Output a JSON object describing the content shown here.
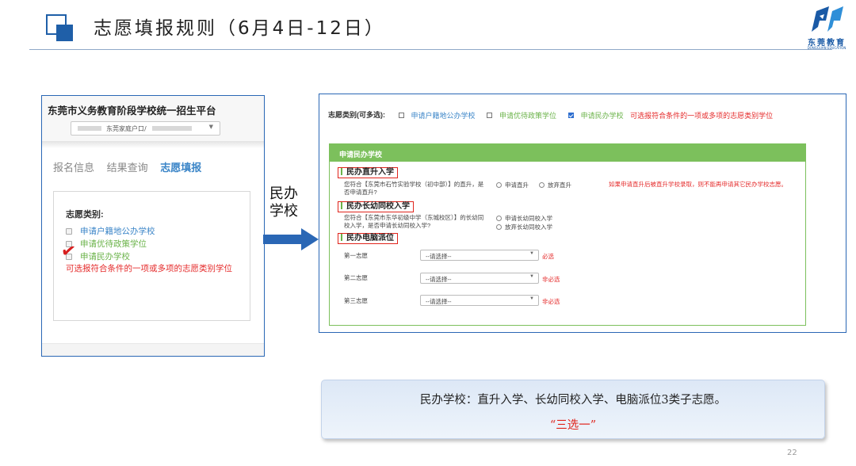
{
  "slide": {
    "title": "志愿填报规则（6月4日-12日）",
    "page_number": "22",
    "logo": {
      "name": "东莞教育",
      "sub": "DONGGUAN EDUCATION"
    }
  },
  "left_screen": {
    "platform_title": "东莞市义务教育阶段学校统一招生平台",
    "account_select": "东莞家庭户口/",
    "tabs": [
      {
        "label": "报名信息",
        "active": false
      },
      {
        "label": "结果查询",
        "active": false
      },
      {
        "label": "志愿填报",
        "active": true
      }
    ],
    "category_label": "志愿类别:",
    "options": [
      {
        "label": "申请户籍地公办学校",
        "color": "#3c86c8"
      },
      {
        "label": "申请优待政策学位",
        "color": "#6bb34a"
      },
      {
        "label": "申请民办学校",
        "color": "#6bb34a"
      }
    ],
    "note": "可选报符合条件的一项或多项的志愿类别学位"
  },
  "middle": {
    "label": "民办学校"
  },
  "right_screen": {
    "category_label": "志愿类别(可多选):",
    "options": [
      {
        "label": "申请户籍地公办学校",
        "checked": false
      },
      {
        "label": "申请优待政策学位",
        "checked": false
      },
      {
        "label": "申请民办学校",
        "checked": true
      }
    ],
    "category_note": "可选报符合条件的一项或多项的志愿类别学位",
    "panel_title": "申请民办学校",
    "direct": {
      "title": "民办直升入学",
      "question": "您符合【东莞市石竹实验学校（初中部）】的直升，是否申请直升?",
      "radios": [
        "申请直升",
        "放弃直升"
      ],
      "warning": "如果申请直升后被直升学校录取，则不能再申请其它民办学校志愿。"
    },
    "kindergarten": {
      "title": "民办长幼同校入学",
      "question": "您符合【东莞市东华初级中学（东城校区）】的长幼同校入学，是否申请长幼同校入学?",
      "radios": [
        "申请长幼同校入学",
        "放弃长幼同校入学"
      ]
    },
    "computer": {
      "title": "民办电脑派位",
      "prefs": [
        {
          "label": "第一志愿",
          "value": "--请选择--",
          "note": "必选"
        },
        {
          "label": "第二志愿",
          "value": "--请选择--",
          "note": "非必选"
        },
        {
          "label": "第三志愿",
          "value": "--请选择--",
          "note": "非必选"
        }
      ]
    }
  },
  "callout": {
    "line1": "民办学校：直升入学、长幼同校入学、电脑派位3类子志愿。",
    "line2": "“三选一”"
  },
  "colors": {
    "brand_blue": "#1f5fa8",
    "panel_green": "#7cc05c",
    "highlight_red": "#e0241c"
  }
}
